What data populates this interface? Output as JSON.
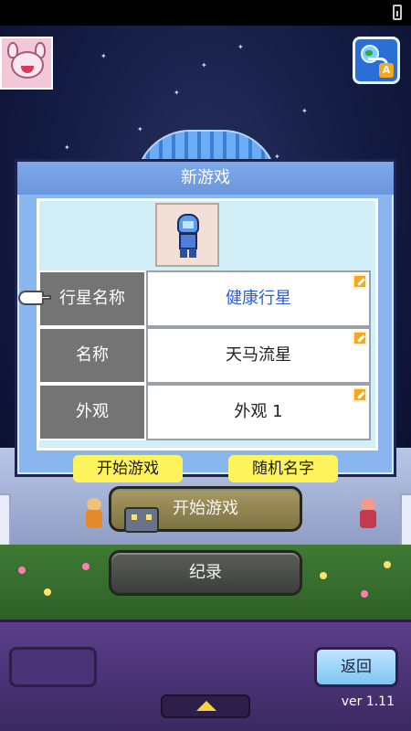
{
  "dialog": {
    "title": "新游戏",
    "fields": [
      {
        "label": "行星名称",
        "value": "健康行星"
      },
      {
        "label": "名称",
        "value": "天马流星"
      },
      {
        "label": "外观",
        "value": "外观 1"
      }
    ],
    "start_button": "开始游戏",
    "random_name_button": "随机名字"
  },
  "menu": {
    "start_game": "开始游戏",
    "records": "纪录"
  },
  "bottom_bar": {
    "back_label": "返回",
    "version": "ver 1.11"
  },
  "icons": [
    "battery-icon",
    "globe-icon",
    "swap-arrows-icon",
    "letter-a-icon",
    "pointer-hand-icon",
    "edit-icon",
    "up-arrow-icon"
  ],
  "colors": {
    "dialog_bg": "#8ab6ef",
    "field_label_bg": "#747474",
    "planet_name_text": "#2f5fcf",
    "yellow_button": "#fff45c",
    "bottom_bar": "#5b3e8a"
  }
}
